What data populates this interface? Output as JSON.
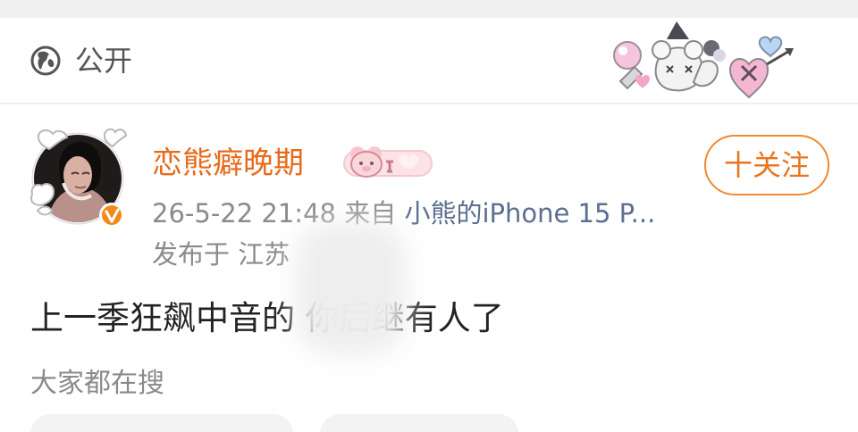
{
  "visibility": {
    "icon": "globe-icon",
    "label": "公开"
  },
  "post": {
    "username": "恋熊癖晚期",
    "timestamp": "26-5-22 21:48",
    "source_prefix": "来自",
    "device": "小熊的iPhone 15 P...",
    "location": "发布于 江苏",
    "follow_label": "十关注",
    "text": "上一季狂飙中音的 你后继有人了"
  },
  "search": {
    "heading": "大家都在搜"
  },
  "colors": {
    "username": "#e86a1a",
    "follow": "#e8761f",
    "meta": "#8a8a8a",
    "device": "#5b6f8f",
    "body_text": "#222222"
  }
}
